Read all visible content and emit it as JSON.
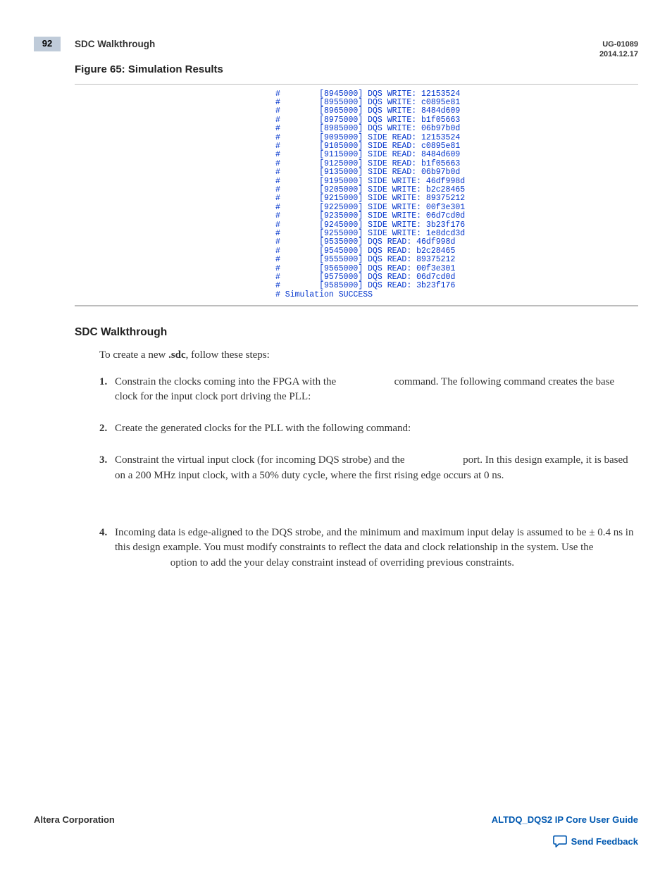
{
  "header": {
    "page_number": "92",
    "breadcrumb": "SDC Walkthrough",
    "doc_id": "UG-01089",
    "doc_date": "2014.12.17"
  },
  "figure": {
    "label": "Figure 65: Simulation Results",
    "lines": [
      "#        [8945000] DQS WRITE: 12153524",
      "#        [8955000] DQS WRITE: c0895e81",
      "#        [8965000] DQS WRITE: 8484d609",
      "#        [8975000] DQS WRITE: b1f05663",
      "#        [8985000] DQS WRITE: 06b97b0d",
      "#        [9095000] SIDE READ: 12153524",
      "#        [9105000] SIDE READ: c0895e81",
      "#        [9115000] SIDE READ: 8484d609",
      "#        [9125000] SIDE READ: b1f05663",
      "#        [9135000] SIDE READ: 06b97b0d",
      "#        [9195000] SIDE WRITE: 46df998d",
      "#        [9205000] SIDE WRITE: b2c28465",
      "#        [9215000] SIDE WRITE: 89375212",
      "#        [9225000] SIDE WRITE: 00f3e301",
      "#        [9235000] SIDE WRITE: 06d7cd0d",
      "#        [9245000] SIDE WRITE: 3b23f176",
      "#        [9255000] SIDE WRITE: 1e8dcd3d",
      "#        [9535000] DQS READ: 46df998d",
      "#        [9545000] DQS READ: b2c28465",
      "#        [9555000] DQS READ: 89375212",
      "#        [9565000] DQS READ: 00f3e301",
      "#        [9575000] DQS READ: 06d7cd0d",
      "#        [9585000] DQS READ: 3b23f176",
      "# Simulation SUCCESS"
    ]
  },
  "section": {
    "heading": "SDC Walkthrough",
    "intro_prefix": "To create a new ",
    "intro_bold": ".sdc",
    "intro_suffix": ", follow these steps:",
    "steps": [
      {
        "num": "1.",
        "pre": "Constrain the clocks coming into the FPGA with the ",
        "post": " command. The following command creates the base clock for the input clock port driving the PLL:"
      },
      {
        "num": "2.",
        "pre": "Create the generated clocks for the PLL with the following command:",
        "post": ""
      },
      {
        "num": "3.",
        "pre": "Constraint the virtual input clock (for incoming DQS strobe) and the ",
        "post": " port. In this design example, it is based on a 200 MHz input clock, with a 50% duty cycle, where the first rising edge occurs at 0 ns."
      },
      {
        "num": "4.",
        "pre": "Incoming data is edge-aligned to the DQS strobe, and the minimum and maximum input delay is assumed to be ± 0.4 ns in this design example. You must modify constraints to reflect the data and clock relationship in the system. Use the ",
        "post": " option to add the your delay constraint instead of overriding previous constraints."
      }
    ]
  },
  "footer": {
    "corp": "Altera Corporation",
    "guide": "ALTDQ_DQS2 IP Core User Guide",
    "feedback": "Send Feedback"
  }
}
